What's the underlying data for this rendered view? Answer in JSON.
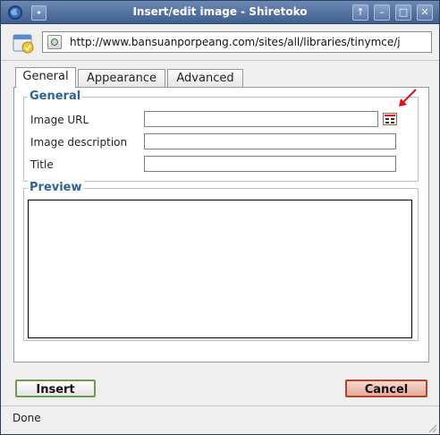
{
  "window": {
    "title": "Insert/edit image - Shiretoko",
    "menu_glyph": "•",
    "controls": {
      "up": "↑",
      "minimize": "–",
      "maximize": "□",
      "close": "✕"
    }
  },
  "urlbar": {
    "url": "http://www.bansuanporpeang.com/sites/all/libraries/tinymce/j"
  },
  "tabs": [
    {
      "label": "General",
      "active": true
    },
    {
      "label": "Appearance",
      "active": false
    },
    {
      "label": "Advanced",
      "active": false
    }
  ],
  "general": {
    "legend": "General",
    "fields": [
      {
        "label": "Image URL",
        "value": ""
      },
      {
        "label": "Image description",
        "value": ""
      },
      {
        "label": "Title",
        "value": ""
      }
    ],
    "browse_icon": "file-browser-icon"
  },
  "preview": {
    "legend": "Preview"
  },
  "buttons": {
    "insert": "Insert",
    "cancel": "Cancel"
  },
  "status": {
    "text": "Done"
  },
  "colors": {
    "titlebar": "#4a6a9c",
    "legend": "#2b6397",
    "insert_border": "#6d9c50",
    "cancel_bg": "#e7a999",
    "annotation_arrow": "#e01010"
  }
}
